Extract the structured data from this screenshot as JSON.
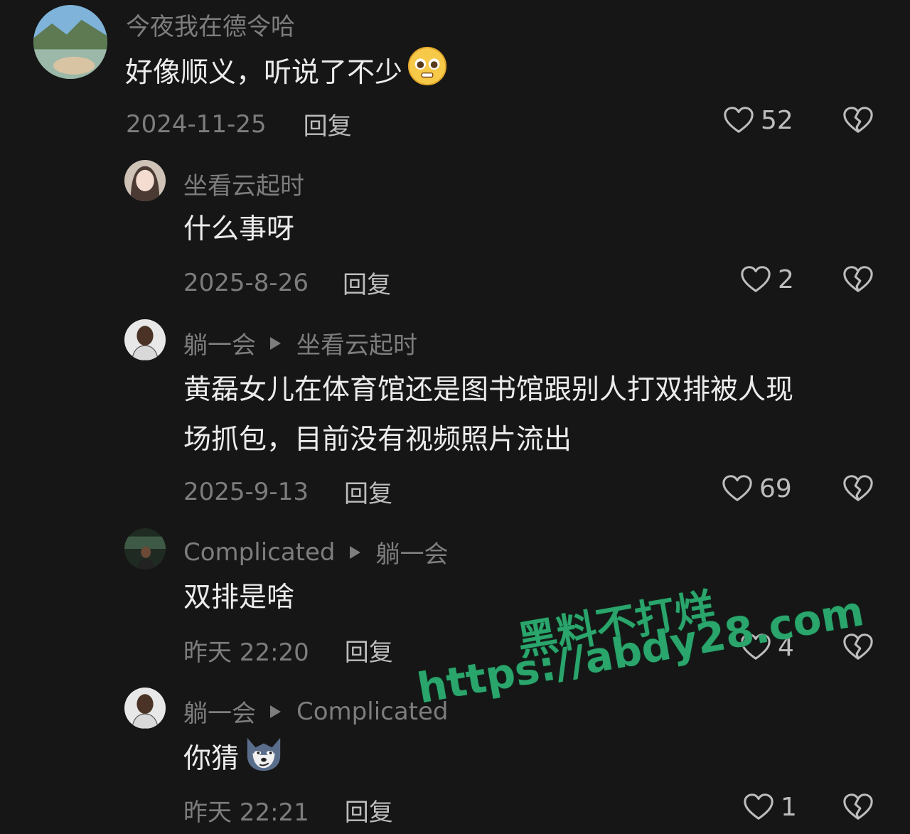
{
  "comments": [
    {
      "username": "今夜我在德令哈",
      "text": "好像顺义，听说了不少",
      "emoji_icon": "pleading-face-icon",
      "date": "2024-11-25",
      "reply_label": "回复",
      "likes": "52"
    },
    {
      "username": "坐看云起时",
      "text": "什么事呀",
      "date": "2025-8-26",
      "reply_label": "回复",
      "likes": "2"
    },
    {
      "username": "躺一会",
      "reply_to": "坐看云起时",
      "text_line1": "黄磊女儿在体育馆还是图书馆跟别人打双排被人现",
      "text_line2": "场抓包，目前没有视频照片流出",
      "date": "2025-9-13",
      "reply_label": "回复",
      "likes": "69"
    },
    {
      "username": "Complicated",
      "reply_to": "躺一会",
      "text": "双排是啥",
      "date": "昨天 22:20",
      "reply_label": "回复",
      "likes": "4"
    },
    {
      "username": "躺一会",
      "reply_to": "Complicated",
      "text": "你猜",
      "emoji_icon": "smirking-husky-icon",
      "date": "昨天 22:21",
      "reply_label": "回复",
      "likes": "1"
    }
  ],
  "watermark": {
    "line1": "黑料不打烊",
    "line2": "https://abdy28.com",
    "color": "#2aa56c"
  }
}
